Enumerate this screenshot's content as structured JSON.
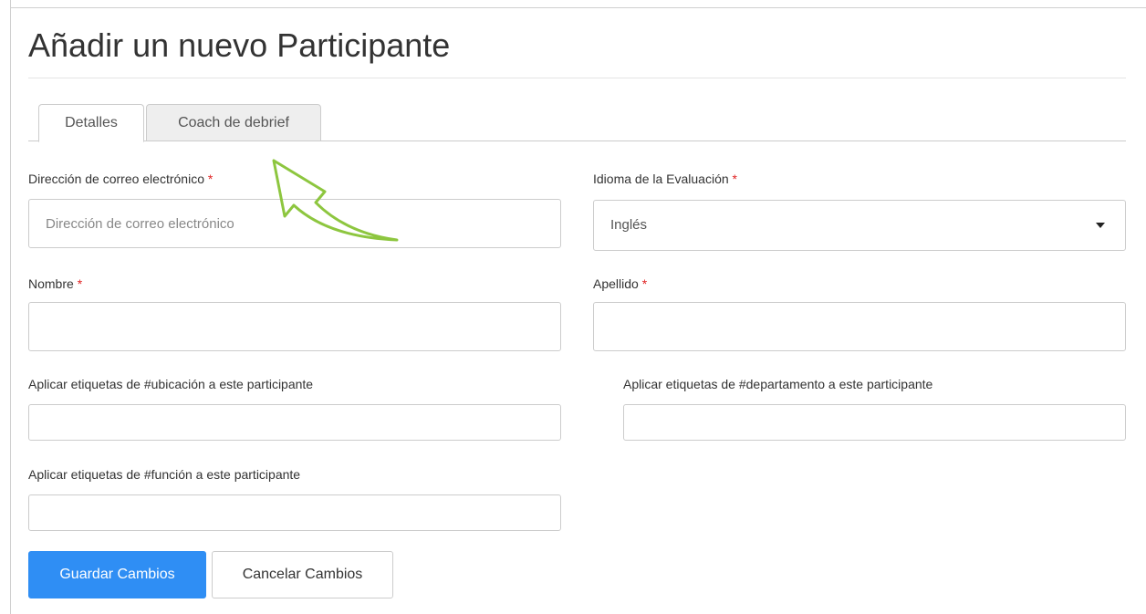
{
  "page": {
    "title": "Añadir un nuevo Participante"
  },
  "tabs": [
    {
      "label": "Detalles",
      "active": true
    },
    {
      "label": "Coach de debrief",
      "active": false
    }
  ],
  "form": {
    "required_marker": "*",
    "email": {
      "label": "Dirección de correo electrónico",
      "placeholder": "Dirección de correo electrónico",
      "value": ""
    },
    "language": {
      "label": "Idioma de la Evaluación",
      "selected": "Inglés"
    },
    "first_name": {
      "label": "Nombre",
      "value": ""
    },
    "last_name": {
      "label": "Apellido",
      "value": ""
    },
    "location_tags": {
      "label": "Aplicar etiquetas de #ubicación a este participante",
      "value": ""
    },
    "department_tags": {
      "label": "Aplicar etiquetas de #departamento a este participante",
      "value": ""
    },
    "function_tags": {
      "label": "Aplicar etiquetas de #función a este participante",
      "value": ""
    }
  },
  "actions": {
    "save_label": "Guardar Cambios",
    "cancel_label": "Cancelar Cambios"
  },
  "colors": {
    "primary": "#2f8ef4",
    "required": "#e02424",
    "annotation_arrow": "#8dc63f"
  },
  "icons": {
    "dropdown": "caret-down-icon",
    "annotation": "curved-arrow-icon"
  }
}
